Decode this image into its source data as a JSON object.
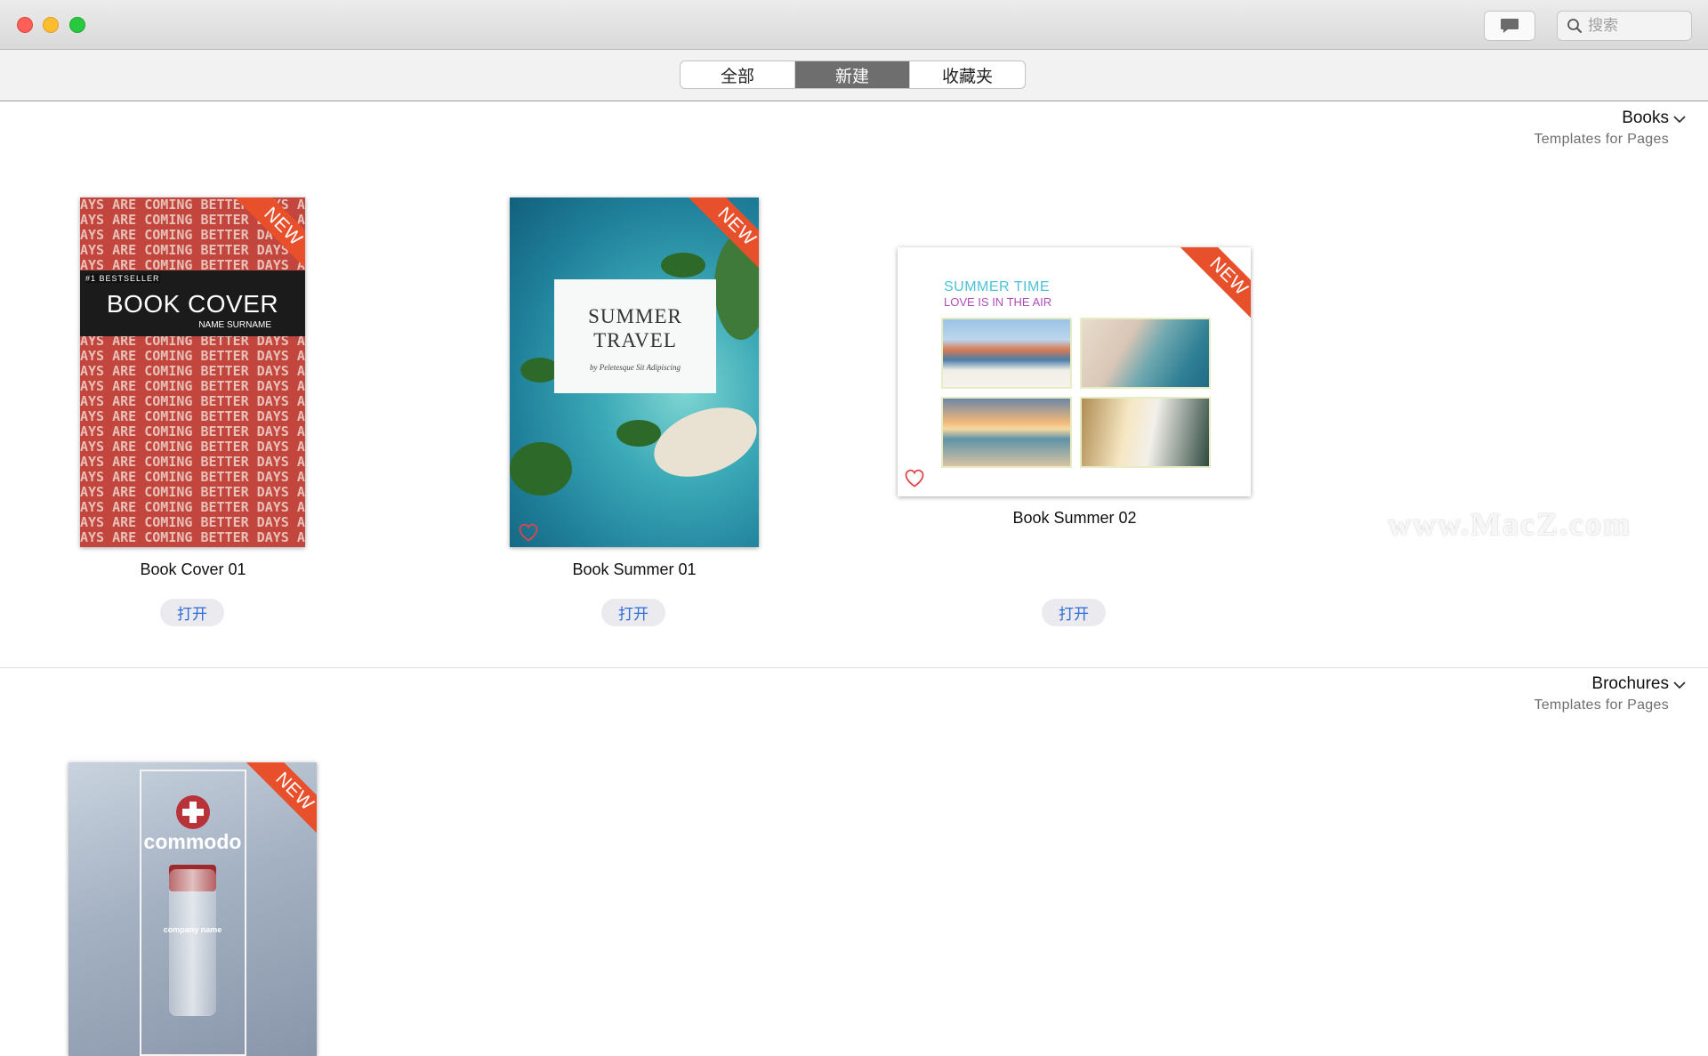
{
  "toolbar": {
    "search_placeholder": "搜索"
  },
  "segments": [
    {
      "label": "全部",
      "active": false
    },
    {
      "label": "新建",
      "active": true
    },
    {
      "label": "收藏夹",
      "active": false
    }
  ],
  "sections": [
    {
      "title": "Books",
      "subtitle": "Templates for Pages"
    },
    {
      "title": "Brochures",
      "subtitle": "Templates for Pages"
    }
  ],
  "books": [
    {
      "name": "Book Cover 01",
      "open_label": "打开",
      "badge": "NEW",
      "cover": {
        "bestseller": "#1 BESTSELLER",
        "title": "BOOK COVER",
        "author": "NAME SURNAME",
        "pattern": "AYS ARE COMING BETTER DAYS AR"
      }
    },
    {
      "name": "Book Summer 01",
      "open_label": "打开",
      "badge": "NEW",
      "cover": {
        "title_line1": "SUMMER",
        "title_line2": "TRAVEL",
        "byline": "by Peletesque Sit Adipiscing"
      }
    },
    {
      "name": "Book Summer 02",
      "open_label": "打开",
      "badge": "NEW",
      "cover": {
        "title_line1": "SUMMER TIME",
        "title_line2": "LOVE IS IN THE AIR"
      }
    }
  ],
  "brochures": [
    {
      "badge": "NEW",
      "cover": {
        "brand": "commodo",
        "company": "company name"
      }
    }
  ],
  "watermark": "www.MacZ.com",
  "colors": {
    "ribbon": "#e8502c",
    "open_text": "#2c6bd8",
    "active_segment": "#6e6e6e"
  }
}
